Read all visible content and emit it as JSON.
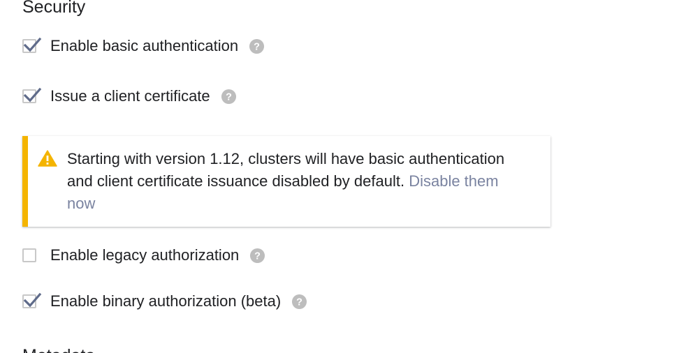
{
  "security": {
    "title": "Security",
    "options": [
      {
        "label": "Enable basic authentication",
        "checked": true
      },
      {
        "label": "Issue a client certificate",
        "checked": true
      },
      {
        "label": "Enable legacy authorization",
        "checked": false
      },
      {
        "label": "Enable binary authorization (beta)",
        "checked": true
      }
    ],
    "notice": {
      "text": "Starting with version 1.12, clusters will have basic authentication and client certificate issuance disabled by default.",
      "link": "Disable them now"
    }
  },
  "next_section": {
    "title": "Metadata"
  },
  "colors": {
    "accent_bar": "#f4b400",
    "checkmark": "#5f6b8a",
    "link": "#7a83a0",
    "help_icon": "#bdbdbd"
  },
  "icons": {
    "warning": "warning-icon",
    "help": "help-icon",
    "checkmark": "checkmark-icon"
  }
}
